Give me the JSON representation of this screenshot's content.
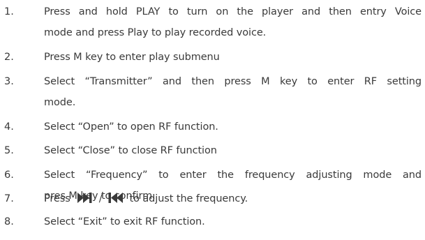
{
  "steps": [
    {
      "number": "1.",
      "lines": [
        "Press and hold PLAY to turn on the player and then entry Voice",
        "mode and press Play to play recorded voice."
      ]
    },
    {
      "number": "2.",
      "lines": [
        "Press M key to enter play submenu"
      ]
    },
    {
      "number": "3.",
      "lines": [
        "Select “Transmitter” and then press M key to enter RF setting",
        "mode."
      ]
    },
    {
      "number": "4.",
      "lines": [
        "Select “Open” to open RF function."
      ]
    },
    {
      "number": "5.",
      "lines": [
        "Select “Close” to close RF function"
      ]
    },
    {
      "number": "6.",
      "lines": [
        "Select “Frequency” to enter the frequency adjusting mode and",
        "pres M key to confirm."
      ]
    },
    {
      "number": "7.",
      "prefix": "Press",
      "separator": "/",
      "suffix": "to adjust the frequency.",
      "icons": [
        "next-track-icon",
        "previous-track-icon"
      ]
    },
    {
      "number": "8.",
      "lines": [
        "Select “Exit” to exit RF function."
      ]
    }
  ]
}
